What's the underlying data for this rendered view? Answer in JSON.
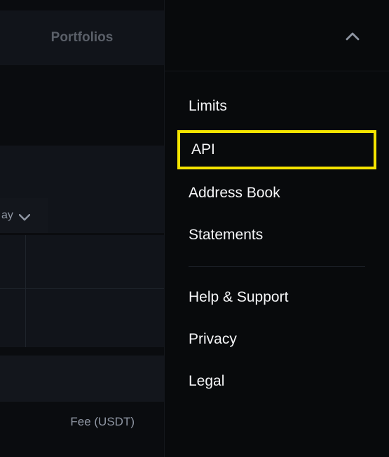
{
  "tabs": {
    "portfolios_label": "Portfolios"
  },
  "dropdown": {
    "visible_text": "ay"
  },
  "footer": {
    "fee_label": "Fee (USDT)"
  },
  "sidePanel": {
    "items": [
      {
        "label": "Limits"
      },
      {
        "label": "API"
      },
      {
        "label": "Address Book"
      },
      {
        "label": "Statements"
      },
      {
        "label": "Help & Support"
      },
      {
        "label": "Privacy"
      },
      {
        "label": "Legal"
      }
    ]
  }
}
